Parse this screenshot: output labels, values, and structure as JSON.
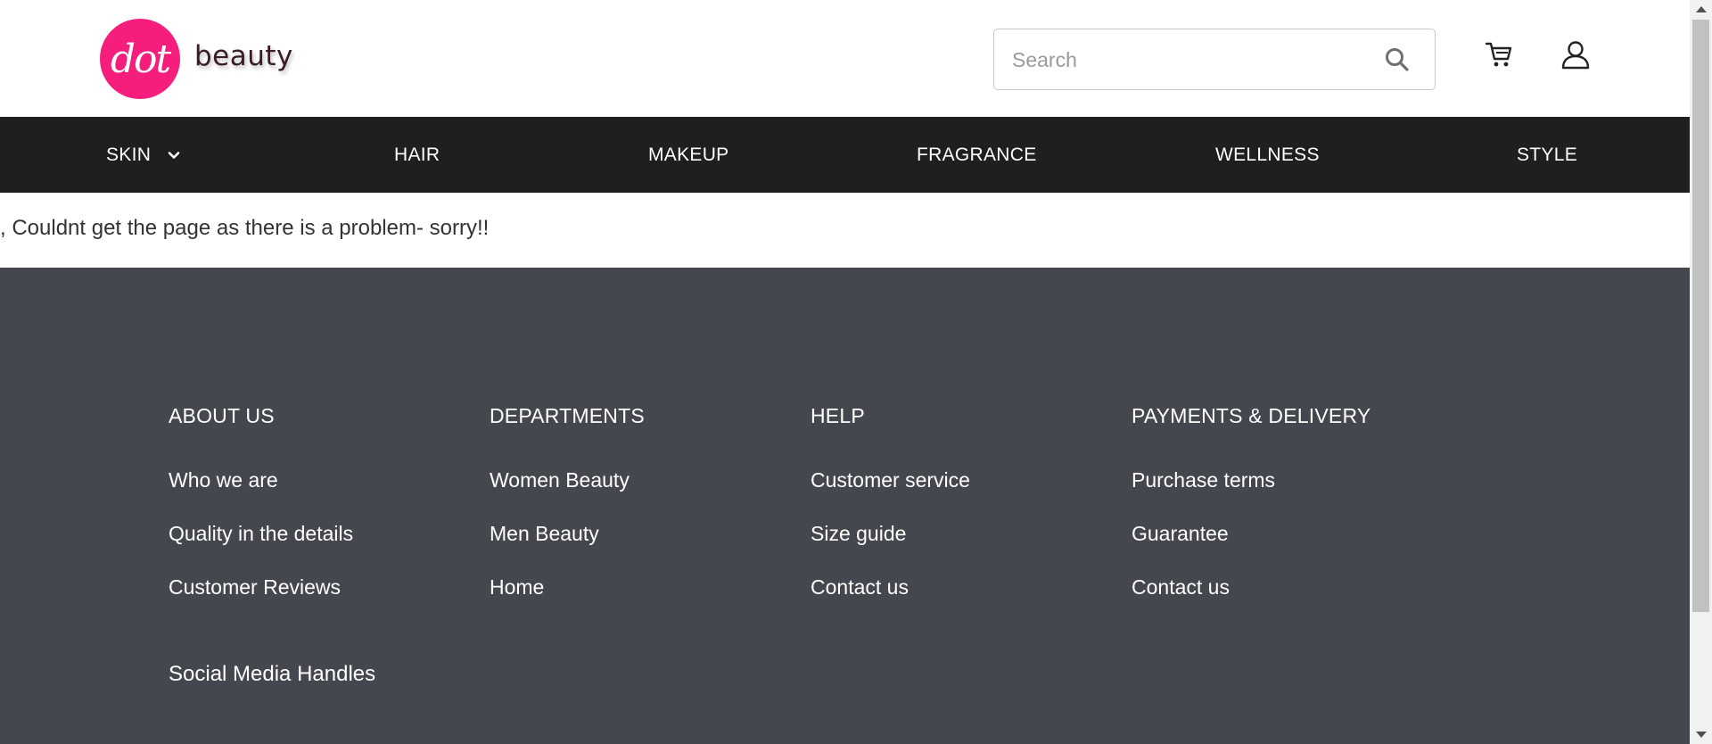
{
  "brand": {
    "logo_text": "dot",
    "name": "beauty",
    "accent_color": "#f51e7d"
  },
  "header": {
    "search": {
      "placeholder": "Search",
      "value": ""
    },
    "icons": [
      "search-icon",
      "cart-icon",
      "user-icon"
    ]
  },
  "nav": {
    "items": [
      {
        "label": "SKIN",
        "has_dropdown": true
      },
      {
        "label": "HAIR"
      },
      {
        "label": "MAKEUP"
      },
      {
        "label": "FRAGRANCE"
      },
      {
        "label": "WELLNESS"
      },
      {
        "label": "STYLE"
      }
    ]
  },
  "message": ", Couldnt get the page as there is a problem- sorry!!",
  "footer": {
    "columns": [
      {
        "title": "ABOUT US",
        "links": [
          "Who we are",
          "Quality in the details",
          "Customer Reviews"
        ]
      },
      {
        "title": "DEPARTMENTS",
        "links": [
          "Women Beauty",
          "Men Beauty",
          "Home"
        ]
      },
      {
        "title": "HELP",
        "links": [
          "Customer service",
          "Size guide",
          "Contact us"
        ]
      },
      {
        "title": "PAYMENTS & DELIVERY",
        "links": [
          "Purchase terms",
          "Guarantee",
          "Contact us"
        ]
      }
    ],
    "social_title": "Social Media Handles",
    "background_color": "#45474f"
  }
}
